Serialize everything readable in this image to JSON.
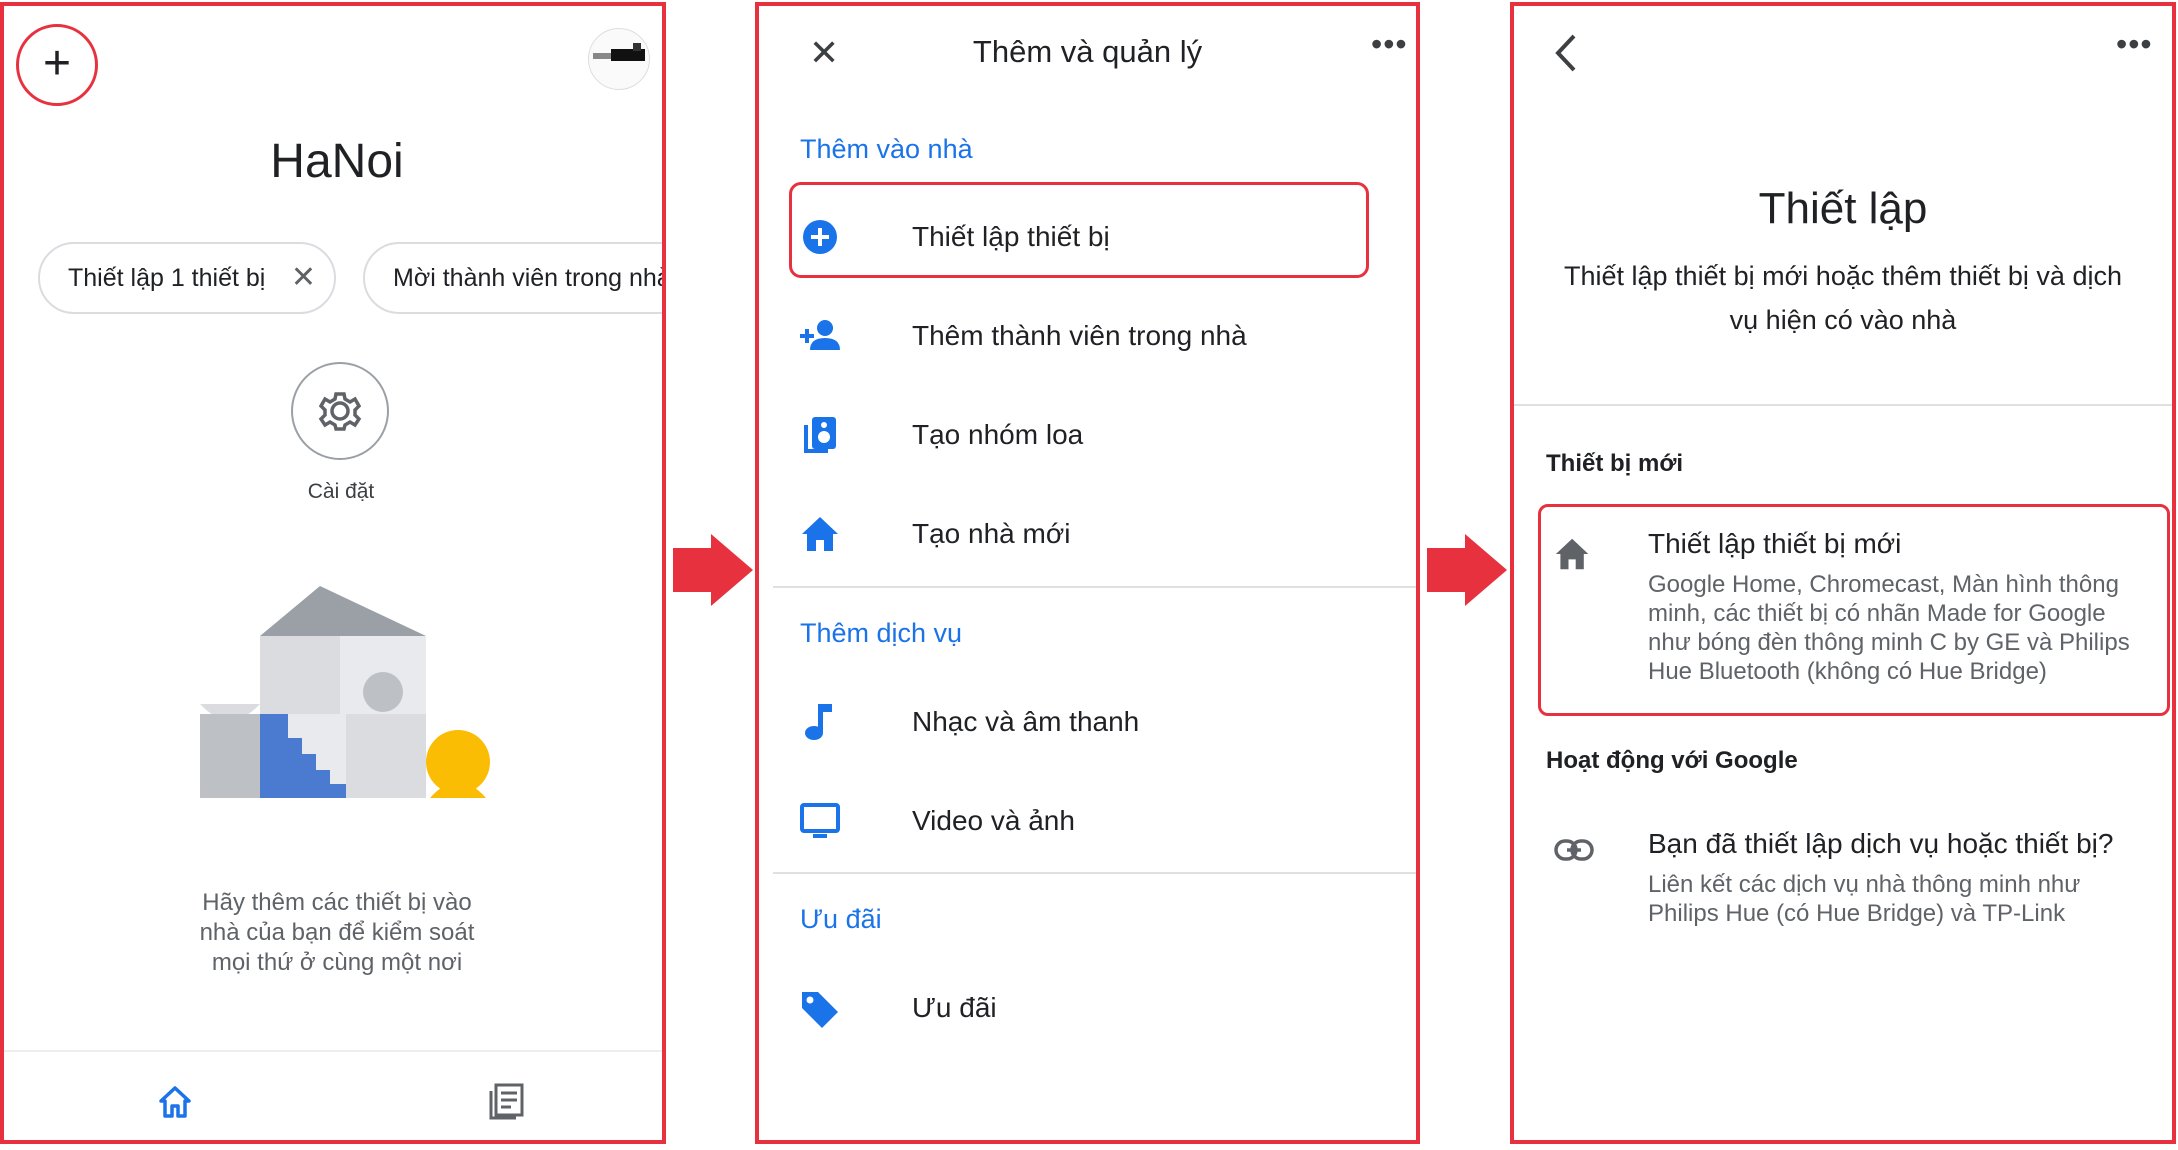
{
  "colors": {
    "highlight": "#e8313f",
    "accent": "#1a73e8",
    "text": "#202124",
    "secondary": "#5f6368"
  },
  "screen1": {
    "add_icon": "plus-icon",
    "title": "HaNoi",
    "chips": [
      "Thiết lập 1 thiết bị",
      "Mời thành viên trong nhà"
    ],
    "settings_label": "Cài đặt",
    "empty_message": "Hãy thêm các thiết bị vào nhà của bạn để kiểm soát mọi thứ ở cùng một nơi",
    "nav": [
      "home-icon",
      "feed-icon"
    ]
  },
  "screen2": {
    "title": "Thêm và quản lý",
    "sections": [
      {
        "header": "Thêm vào nhà",
        "items": [
          {
            "label": "Thiết lập thiết bị",
            "icon": "add-circle-icon"
          },
          {
            "label": "Thêm thành viên trong nhà",
            "icon": "person-add-icon"
          },
          {
            "label": "Tạo nhóm loa",
            "icon": "speaker-group-icon"
          },
          {
            "label": "Tạo nhà mới",
            "icon": "home-icon"
          }
        ]
      },
      {
        "header": "Thêm dịch vụ",
        "items": [
          {
            "label": "Nhạc và âm thanh",
            "icon": "music-note-icon"
          },
          {
            "label": "Video và ảnh",
            "icon": "tv-icon"
          }
        ]
      },
      {
        "header": "Ưu đãi",
        "items": [
          {
            "label": "Ưu đãi",
            "icon": "tag-icon"
          }
        ]
      }
    ]
  },
  "screen3": {
    "title": "Thiết lập",
    "subtitle": "Thiết lập thiết bị mới hoặc thêm thiết bị và dịch vụ hiện có vào nhà",
    "sections": [
      {
        "header": "Thiết bị mới",
        "item": {
          "title": "Thiết lập thiết bị mới",
          "description": "Google Home, Chromecast, Màn hình thông minh, các thiết bị có nhãn Made for Google như bóng đèn thông minh C by GE và Philips Hue Bluetooth (không có Hue Bridge)",
          "icon": "home-icon"
        }
      },
      {
        "header": "Hoạt động với Google",
        "item": {
          "title": "Bạn đã thiết lập dịch vụ hoặc thiết bị?",
          "description": "Liên kết các dịch vụ nhà thông minh như Philips Hue (có Hue Bridge) và TP-Link",
          "icon": "link-icon"
        }
      }
    ]
  }
}
